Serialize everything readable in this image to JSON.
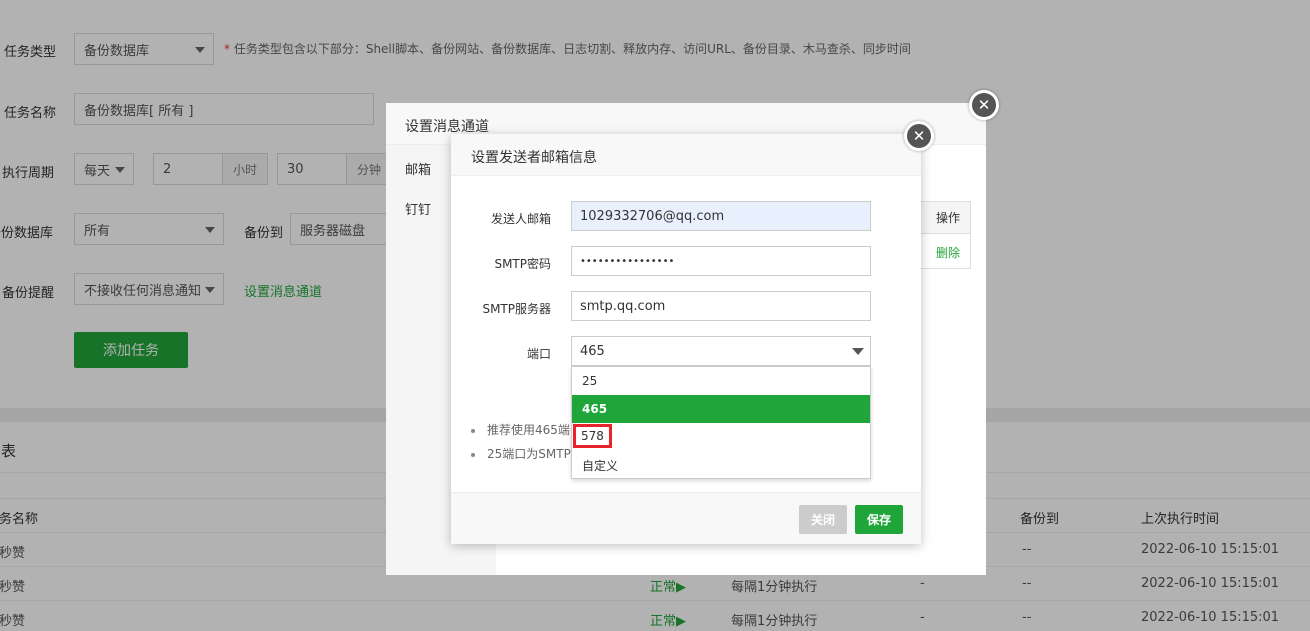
{
  "form": {
    "task_type_label": "任务类型",
    "task_type_value": "备份数据库",
    "task_type_hint_star": "*",
    "task_type_hint": "任务类型包含以下部分：Shell脚本、备份网站、备份数据库、日志切割、释放内存、访问URL、备份目录、木马查杀、同步时间",
    "task_name_label": "任务名称",
    "task_name_value": "备份数据库[ 所有 ]",
    "period_label": "执行周期",
    "period_value": "每天",
    "hour_value": "2",
    "hour_unit": "小时",
    "minute_value": "30",
    "minute_unit": "分钟",
    "db_label": "备份数据库",
    "db_value": "所有",
    "backup_to_label": "备份到",
    "backup_to_value": "服务器磁盘",
    "remind_label": "备份提醒",
    "remind_value": "不接收任何消息通知",
    "set_channel_link": "设置消息通道",
    "add_task_button": "添加任务"
  },
  "list": {
    "title": "列表",
    "headers": {
      "name": "任务名称",
      "backup_to": "备份到",
      "last_run": "上次执行时间"
    },
    "rows": [
      {
        "name": "同秒赞",
        "status": "",
        "period": "",
        "backup_to": "",
        "dash_backup": "--",
        "last_run": "2022-06-10 15:15:01"
      },
      {
        "name": "同秒赞",
        "status": "正常▶",
        "period": "每隔1分钟执行",
        "backup_to": "-",
        "dash_backup": "--",
        "last_run": "2022-06-10 15:15:01"
      },
      {
        "name": "同秒赞",
        "status": "正常▶",
        "period": "每隔1分钟执行",
        "backup_to": "-",
        "dash_backup": "--",
        "last_run": "2022-06-10 15:15:01"
      }
    ]
  },
  "outer_dialog": {
    "title": "设置消息通道",
    "tabs": [
      "邮箱",
      "钉钉"
    ],
    "table_header": "操作",
    "table_action": "删除",
    "close_glyph": "✕"
  },
  "inner_dialog": {
    "title": "设置发送者邮箱信息",
    "close_glyph": "✕",
    "sender_label": "发送人邮箱",
    "sender_value": "1029332706@qq.com",
    "password_label": "SMTP密码",
    "password_value": "••••••••••••••••",
    "server_label": "SMTP服务器",
    "server_value": "smtp.qq.com",
    "port_label": "端口",
    "port_value": "465",
    "port_options": [
      "25",
      "465",
      "578",
      "自定义"
    ],
    "tip1": "推荐使用465端",
    "tip2": "25端口为SMTP",
    "close_button": "关闭",
    "save_button": "保存"
  },
  "colors": {
    "accent": "#20a53a",
    "highlight_border": "#e8242a"
  }
}
